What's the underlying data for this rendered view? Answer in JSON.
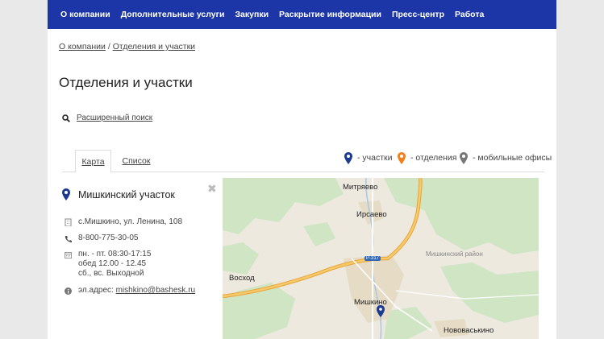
{
  "nav": {
    "items": [
      {
        "label": "О компании"
      },
      {
        "label": "Дополнительные услуги"
      },
      {
        "label": "Закупки"
      },
      {
        "label": "Раскрытие информации"
      },
      {
        "label": "Пресс-центр"
      },
      {
        "label": "Работа"
      }
    ]
  },
  "breadcrumb": {
    "items": [
      "О компании",
      "Отделения и участки"
    ],
    "separator": "/"
  },
  "page_title": "Отделения и участки",
  "search": {
    "label": "Расширенный поиск",
    "icon": "search-icon"
  },
  "tabs": [
    {
      "label": "Карта",
      "active": true
    },
    {
      "label": "Список",
      "active": false
    }
  ],
  "legend": [
    {
      "label": "- участки",
      "color": "#1c3a8f",
      "icon": "map-pin-icon"
    },
    {
      "label": "- отделения",
      "color": "#f07f1c",
      "icon": "map-pin-icon"
    },
    {
      "label": "- мобильные офисы",
      "color": "#777777",
      "icon": "map-pin-icon"
    }
  ],
  "office": {
    "name": "Мишкинский участок",
    "address": "с.Мишкино, ул. Ленина, 108",
    "phone": "8-800-775-30-05",
    "hours": [
      "пн. - пт. 08:30-17:15",
      "обед 12.00 - 12.45",
      "сб., вс. Выходной"
    ],
    "email_label": "эл.адрес:",
    "email": "mishkino@bashesk.ru",
    "close": "✖"
  },
  "map": {
    "labels": {
      "mitryaevo": "Митряево",
      "irsaevo": "Ирсаево",
      "voskhod": "Восход",
      "mishkino": "Мишкино",
      "novovaskino": "Нововаськино",
      "district": "Мишкинский район",
      "road": "Р-317"
    },
    "colors": {
      "background": "#ede9df",
      "forest": "#cfe5c4",
      "road": "#f3b94f",
      "pin": "#1c3a8f"
    }
  }
}
